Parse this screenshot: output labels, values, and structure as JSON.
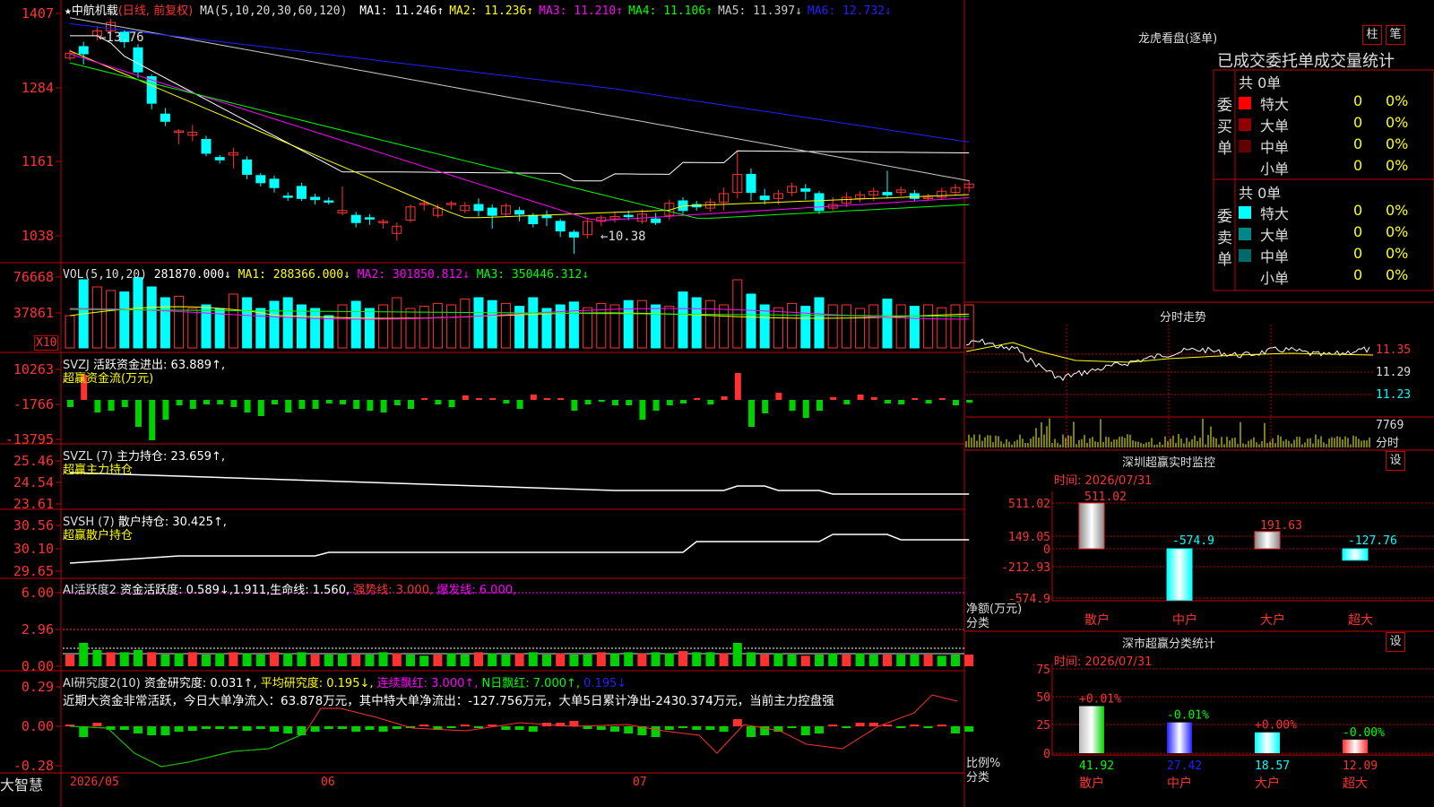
{
  "colors": {
    "up": "#ff3232",
    "down": "#00ffff",
    "border": "#c00000",
    "grid_dash": "#7a0000",
    "text": "#dddddd",
    "ma1": "#ffffff",
    "ma2": "#ffff00",
    "ma3": "#ff00ff",
    "ma4": "#00ff00",
    "ma5": "#c8c8c8",
    "ma6": "#2020ff",
    "green_bar": "#00d000"
  },
  "kline": {
    "star": "★",
    "stock_name": "中航机载",
    "mode": "(日线, 前复权)",
    "ma_title": "MA(5,10,20,30,60,120)",
    "ma_values": [
      {
        "label": "MA1:",
        "value": "11.246↑",
        "color": "#ffffff"
      },
      {
        "label": "MA2:",
        "value": "11.236↑",
        "color": "#ffff00"
      },
      {
        "label": "MA3:",
        "value": "11.210↑",
        "color": "#ff00ff"
      },
      {
        "label": "MA4:",
        "value": "11.106↑",
        "color": "#00ff00"
      },
      {
        "label": "MA5:",
        "value": "11.397↓",
        "color": "#c8c8c8"
      },
      {
        "label": "MA6:",
        "value": "12.732↓",
        "color": "#2020ff"
      }
    ],
    "y_labels": [
      "1407",
      "1284",
      "1161",
      "1038"
    ],
    "high_label": "←13.76",
    "low_label": "←10.38"
  },
  "vol": {
    "title": "VOL(5,10,20)",
    "value": "281870.000↓",
    "ma1": "MA1: 288366.000↓",
    "ma2": "MA2: 301850.812↓",
    "ma3": "MA3: 350446.312↓",
    "y_labels": [
      "76668",
      "37861"
    ],
    "unit": "X10"
  },
  "svzj": {
    "title": "SVZJ",
    "line1": "活跃资金进出: 63.889↑,",
    "line2": "超赢资金流(万元)",
    "y_labels": [
      "10263",
      "-1766",
      "-13795"
    ]
  },
  "svzl": {
    "title": "SVZL (7)",
    "line1": "主力持仓: 23.659↑,",
    "line2": "超赢主力持仓",
    "y_labels": [
      "25.46",
      "24.54",
      "23.61"
    ]
  },
  "svsh": {
    "title": "SVSH (7)",
    "line1": "散户持仓: 30.425↑,",
    "line2": "超赢散户持仓",
    "y_labels": [
      "30.56",
      "30.10",
      "29.65"
    ]
  },
  "ai1": {
    "title": "AI活跃度2",
    "text": "资金活跃度: 0.589↓,1.911,生命线: 1.560,",
    "strong": "强势线: 3.000,",
    "burst": "爆发线: 6.000,",
    "y_labels": [
      "6.00",
      "2.96",
      "0.00"
    ]
  },
  "ai2": {
    "title": "AI研究度2(10)",
    "text1": "资金研究度: 0.031↑,",
    "text2": "平均研究度: 0.195↓,",
    "text3": "连续飘红: 3.000↑,",
    "text4": "N日飘红: 7.000↑,",
    "text5": "0.195↓",
    "summary": "近期大资金非常活跃，今日大单净流入：63.878万元，其中特大单净流出：-127.756万元，大单5日累计净出-2430.374万元，当前主力控盘强",
    "y_labels": [
      "0.29",
      "0.00",
      "-0.28"
    ]
  },
  "xaxis": {
    "brand": "大智慧",
    "labels": [
      "2026/05",
      "06",
      "07"
    ]
  },
  "right": {
    "header": "龙虎看盘(逐单)",
    "btn_zhu": "柱",
    "btn_bi": "笔",
    "subtitle": "已成交委托单成交量统计",
    "buy": {
      "label": "委买单",
      "total": "共 0单",
      "rows": [
        {
          "name": "特大",
          "count": "0",
          "pct": "0%",
          "color": "#ff0000"
        },
        {
          "name": "大单",
          "count": "0",
          "pct": "0%",
          "color": "#900000"
        },
        {
          "name": "中单",
          "count": "0",
          "pct": "0%",
          "color": "#600000"
        },
        {
          "name": "小单",
          "count": "0",
          "pct": "0%",
          "color": ""
        }
      ]
    },
    "sell": {
      "label": "委卖单",
      "total": "共 0单",
      "rows": [
        {
          "name": "特大",
          "count": "0",
          "pct": "0%",
          "color": "#00ffff"
        },
        {
          "name": "大单",
          "count": "0",
          "pct": "0%",
          "color": "#008888"
        },
        {
          "name": "中单",
          "count": "0",
          "pct": "0%",
          "color": "#006a6a"
        },
        {
          "name": "小单",
          "count": "0",
          "pct": "0%",
          "color": ""
        }
      ]
    },
    "intraday": {
      "title": "分时走势",
      "y_labels": [
        "11.35",
        "11.29",
        "11.23"
      ],
      "vol_label": "7769",
      "vol_caption": "分时"
    },
    "monitor": {
      "title": "深圳超赢实时监控",
      "setting": "设",
      "time": "时间: 2026/07/31",
      "y_labels": [
        "511.02",
        "149.05",
        "0",
        "-212.93",
        "-574.9"
      ],
      "axis_caption1": "净额(万元)",
      "axis_caption2": "分类",
      "categories": [
        "散户",
        "中户",
        "大户",
        "超大"
      ],
      "values": [
        511.02,
        -574.9,
        191.63,
        -127.76
      ],
      "value_labels": [
        "511.02",
        "-574.9",
        "191.63",
        "-127.76"
      ]
    },
    "stats": {
      "title": "深市超赢分类统计",
      "setting": "设",
      "time": "时间: 2026/07/31",
      "y_labels": [
        "75",
        "50",
        "25",
        "0"
      ],
      "axis_caption1": "比例%",
      "axis_caption2": "分类",
      "categories": [
        "散户",
        "中户",
        "大户",
        "超大"
      ],
      "values": [
        41.92,
        27.42,
        18.57,
        12.09
      ],
      "change_labels": [
        "+0.01%",
        "-0.01%",
        "+0.00%",
        "-0.00%"
      ],
      "value_labels": [
        "41.92",
        "27.42",
        "18.57",
        "12.09"
      ]
    }
  }
}
